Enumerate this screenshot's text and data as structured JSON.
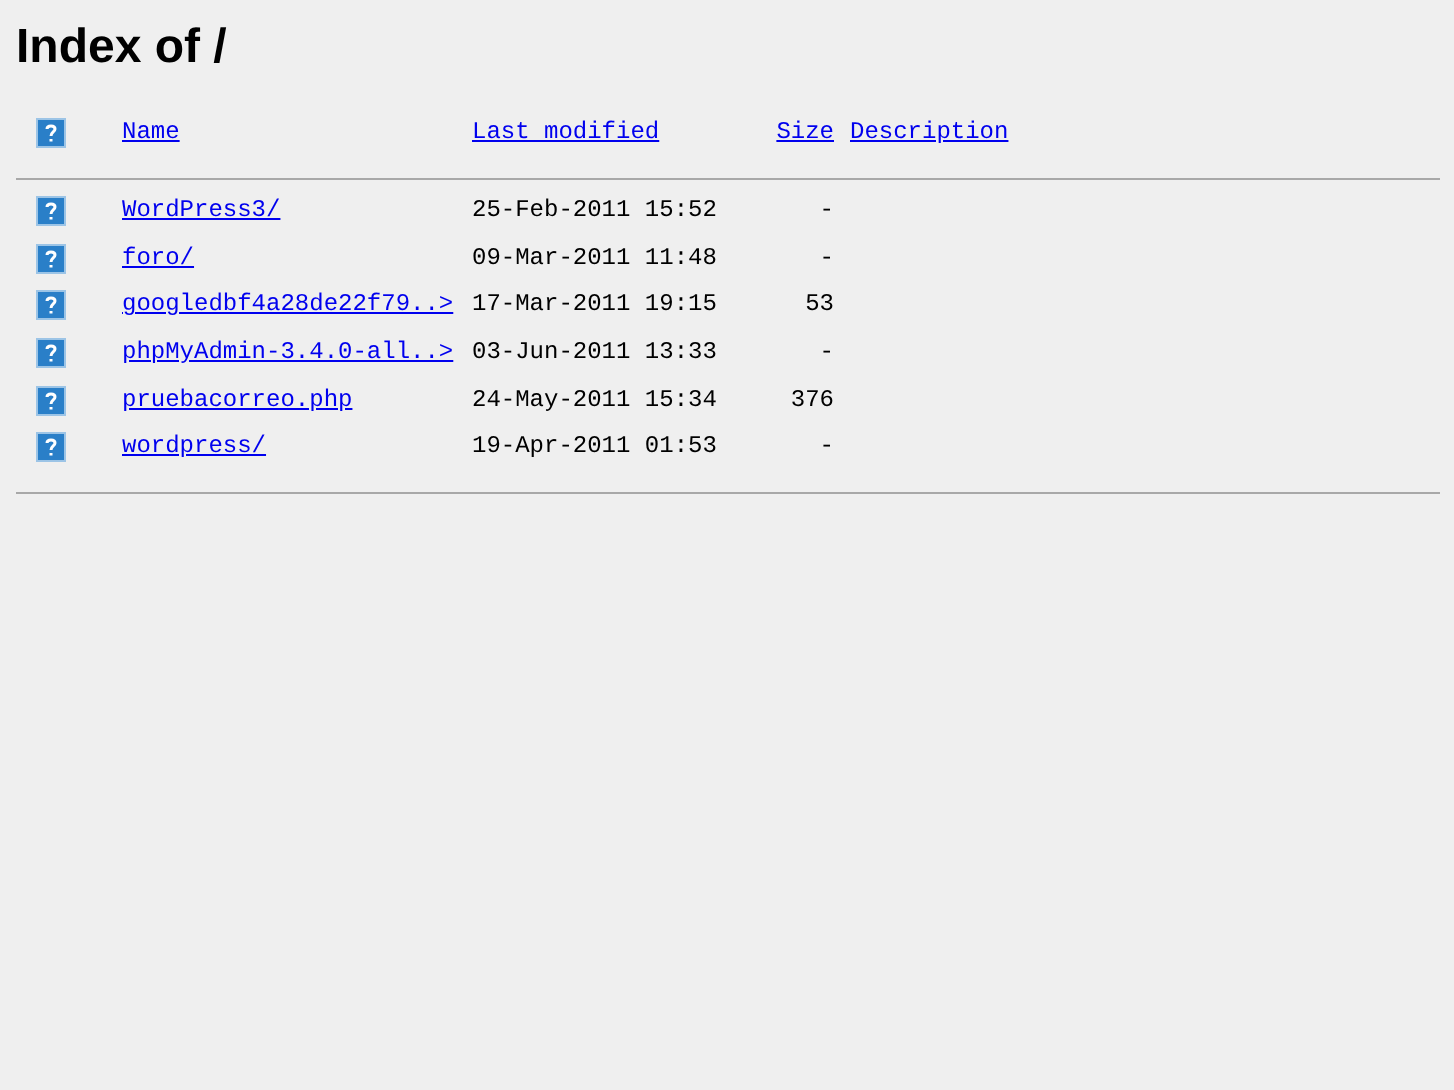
{
  "title": "Index of /",
  "columns": [
    "Name",
    "Last modified",
    "Size",
    "Description"
  ],
  "rows": [
    {
      "name": "WordPress3/",
      "modified": "25-Feb-2011 15:52",
      "size": "-"
    },
    {
      "name": "foro/",
      "modified": "09-Mar-2011 11:48",
      "size": "-"
    },
    {
      "name": "googledbf4a28de22f79..>",
      "modified": "17-Mar-2011 19:15",
      "size": "53"
    },
    {
      "name": "phpMyAdmin-3.4.0-all..>",
      "modified": "03-Jun-2011 13:33",
      "size": "-"
    },
    {
      "name": "pruebacorreo.php",
      "modified": "24-May-2011 15:34",
      "size": "376"
    },
    {
      "name": "wordpress/",
      "modified": "19-Apr-2011 01:53",
      "size": "-"
    }
  ]
}
